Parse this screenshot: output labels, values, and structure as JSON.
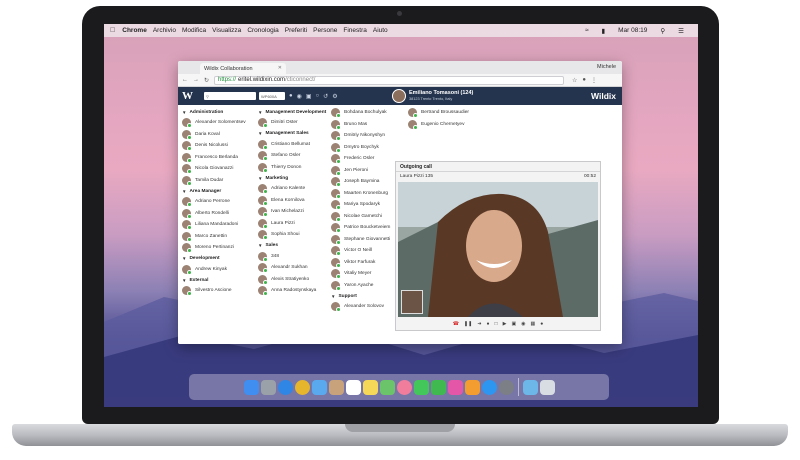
{
  "menubar": {
    "app": "Chrome",
    "items": [
      "Archivio",
      "Modifica",
      "Visualizza",
      "Cronologia",
      "Preferiti",
      "Persone",
      "Finestra",
      "Aiuto"
    ],
    "clock": "Mar 08:19"
  },
  "browser": {
    "tab_title": "Wildix Collaboration",
    "profile": "Michele",
    "url_scheme": "https://",
    "url_host": "eritel.wildixin.com",
    "url_path": "/cticonnect/"
  },
  "app_header": {
    "logo": "W",
    "select_value": "WP600A",
    "user_name": "Emiliano Tomasoni (124)",
    "user_address": "38123 Trento Trento, Italy",
    "brand": "Wildix"
  },
  "contacts": {
    "col1": [
      {
        "type": "group",
        "label": "Administration"
      },
      {
        "type": "contact",
        "name": "Alexander Solomentsev"
      },
      {
        "type": "contact",
        "name": "Daria Koval"
      },
      {
        "type": "contact",
        "name": "Denis Nicolussi"
      },
      {
        "type": "contact",
        "name": "Francesco Berlanda"
      },
      {
        "type": "contact",
        "name": "Nicola Giovanazzi"
      },
      {
        "type": "contact",
        "name": "Tamila Dudar"
      },
      {
        "type": "group",
        "label": "Area Manager"
      },
      {
        "type": "contact",
        "name": "Adriano Perrone"
      },
      {
        "type": "contact",
        "name": "Alberto Rondelli"
      },
      {
        "type": "contact",
        "name": "Liliana Mandaradoni"
      },
      {
        "type": "contact",
        "name": "Marco Zanettin"
      },
      {
        "type": "contact",
        "name": "Moreno Pertinanzi"
      },
      {
        "type": "group",
        "label": "Development"
      },
      {
        "type": "contact",
        "name": "Andrew Kinyak"
      },
      {
        "type": "group",
        "label": "External"
      },
      {
        "type": "contact",
        "name": "Silvestro Ascione"
      }
    ],
    "col2": [
      {
        "type": "group",
        "label": "Management Development"
      },
      {
        "type": "contact",
        "name": "Dimitri Oster"
      },
      {
        "type": "group",
        "label": "Management Sales"
      },
      {
        "type": "contact",
        "name": "Cristiano Bellumat"
      },
      {
        "type": "contact",
        "name": "Stefano Osler"
      },
      {
        "type": "contact",
        "name": "Thierry Donon"
      },
      {
        "type": "group",
        "label": "Marketing"
      },
      {
        "type": "contact",
        "name": "Adriano Kalente"
      },
      {
        "type": "contact",
        "name": "Elena Kornilova"
      },
      {
        "type": "contact",
        "name": "Ivan Michelazzi"
      },
      {
        "type": "contact",
        "name": "Laura Pizzi"
      },
      {
        "type": "contact",
        "name": "Sophia Shoui"
      },
      {
        "type": "group",
        "label": "Sales"
      },
      {
        "type": "contact",
        "name": "348"
      },
      {
        "type": "contact",
        "name": "Alexandr Sukhan"
      },
      {
        "type": "contact",
        "name": "Alexis Stratiyenko"
      },
      {
        "type": "contact",
        "name": "Anna Radostynskaya"
      }
    ],
    "col3": [
      {
        "type": "contact",
        "name": "Bohdana Bochulyak"
      },
      {
        "type": "contact",
        "name": "Bruno Mas"
      },
      {
        "type": "contact",
        "name": "Dmitriy Nikonyshyn"
      },
      {
        "type": "contact",
        "name": "Dmytro Boychyk"
      },
      {
        "type": "contact",
        "name": "Frederic Osler"
      },
      {
        "type": "contact",
        "name": "Jen Pieroni"
      },
      {
        "type": "contact",
        "name": "Joseph Baymina"
      },
      {
        "type": "contact",
        "name": "Maarten Kronenburg"
      },
      {
        "type": "contact",
        "name": "Mariya Spodaryk"
      },
      {
        "type": "contact",
        "name": "Nicolae Gametchi"
      },
      {
        "type": "contact",
        "name": "Patrice Boucketveiem"
      },
      {
        "type": "contact",
        "name": "Stephane Giovannetti"
      },
      {
        "type": "contact",
        "name": "Victor O Neill"
      },
      {
        "type": "contact",
        "name": "Viktor Farfurak"
      },
      {
        "type": "contact",
        "name": "Vitaliy Meyer"
      },
      {
        "type": "contact",
        "name": "Yaron Ayache"
      },
      {
        "type": "group",
        "label": "Support"
      },
      {
        "type": "contact",
        "name": "Alexander Solovov"
      }
    ],
    "col4": [
      {
        "type": "contact",
        "name": "Bertrand Broussaudier"
      },
      {
        "type": "contact",
        "name": "Eugenio Chernetyev"
      }
    ]
  },
  "call": {
    "title": "Outgoing call",
    "caller": "Laura Pizzi 135",
    "duration": "00:52"
  },
  "colors": {
    "app_header": "#24344e",
    "hangup": "#d52a2a",
    "presence": "#3cb44a"
  }
}
